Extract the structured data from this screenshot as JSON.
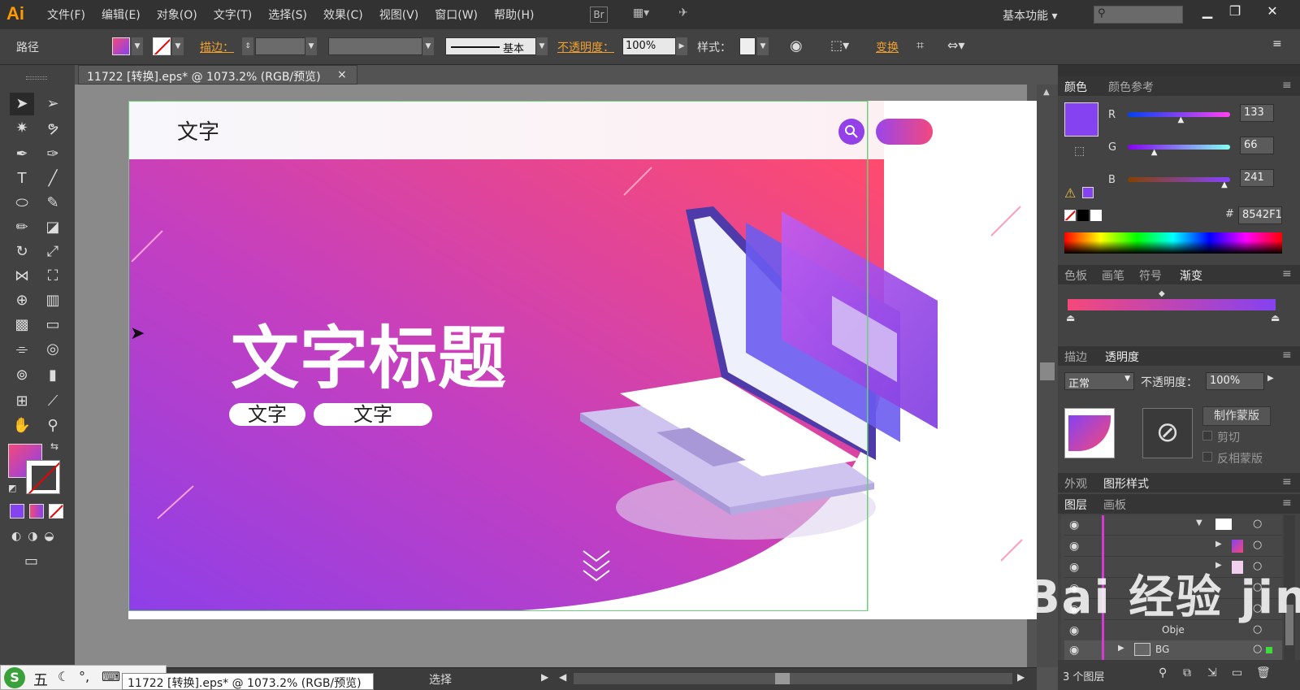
{
  "app": {
    "logo": "Ai"
  },
  "menu": [
    "文件(F)",
    "编辑(E)",
    "对象(O)",
    "文字(T)",
    "选择(S)",
    "效果(C)",
    "视图(V)",
    "窗口(W)",
    "帮助(H)"
  ],
  "bridge_label": "Br",
  "workspace": "基本功能",
  "control": {
    "path_label": "路径",
    "stroke_label": "描边：",
    "stroke_style": "基本",
    "opacity_label": "不透明度：",
    "opacity_value": "100%",
    "style_label": "样式：",
    "transform_label": "变换"
  },
  "document": {
    "tab_title": "11722 [转换].eps* @ 1073.2% (RGB/预览)",
    "close": "×"
  },
  "artboard": {
    "nav_text": "文字",
    "headline": "文字标题",
    "pill1": "文字",
    "pill2": "文字"
  },
  "color_panel": {
    "tabs": [
      "颜色",
      "颜色参考"
    ],
    "r_label": "R",
    "g_label": "G",
    "b_label": "B",
    "r": "133",
    "g": "66",
    "b": "241",
    "r_frac": 0.52,
    "g_frac": 0.26,
    "b_frac": 0.945,
    "hex_label": "#",
    "hex": "8542F1",
    "fill": "#8542F1"
  },
  "swatch_tabs": [
    "色板",
    "画笔",
    "符号",
    "渐变"
  ],
  "gradient": {
    "start": "#f5487a",
    "end": "#8542f1"
  },
  "transparency": {
    "tabs": [
      "描边",
      "透明度"
    ],
    "mode": "正常",
    "opacity_label": "不透明度：",
    "opacity": "100%",
    "make_mask": "制作蒙版",
    "clip": "剪切",
    "invert": "反相蒙版"
  },
  "appearance_tabs": [
    "外观",
    "图形样式"
  ],
  "layers": {
    "tabs": [
      "图层",
      "画板"
    ],
    "rows": [
      "",
      "",
      "",
      "",
      "",
      "",
      "Obje",
      "BG"
    ],
    "count": "3 个图层"
  },
  "status": {
    "mode": "选择",
    "tooltip": "11722 [转换].eps* @ 1073.2% (RGB/预览)"
  },
  "ime": {
    "label": "五"
  },
  "watermark": "Bai 经验 jingyan.baidu"
}
